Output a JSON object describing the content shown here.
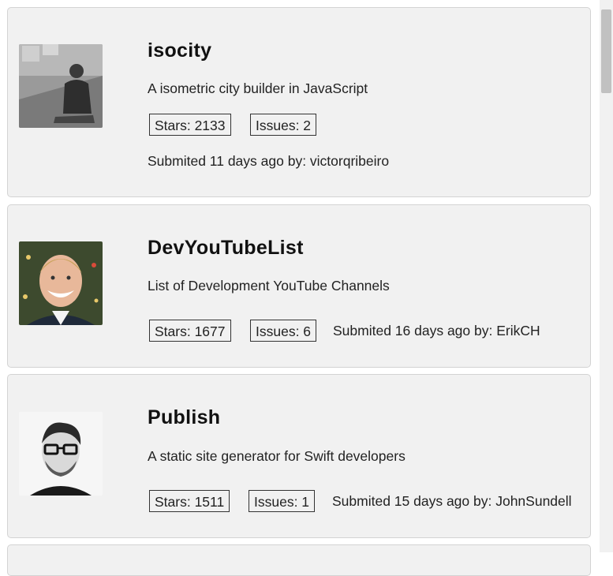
{
  "repos": [
    {
      "name": "isocity",
      "description": "A isometric city builder in JavaScript",
      "stars_label": "Stars: 2133",
      "issues_label": "Issues: 2",
      "submitted_label": "Submited 11 days ago by: victorqribeiro",
      "avatar_icon": "user-photo-grayscale"
    },
    {
      "name": "DevYouTubeList",
      "description": "List of Development YouTube Channels",
      "stars_label": "Stars: 1677",
      "issues_label": "Issues: 6",
      "submitted_label": "Submited 16 days ago by: ErikCH",
      "avatar_icon": "user-photo-color"
    },
    {
      "name": "Publish",
      "description": "A static site generator for Swift developers",
      "stars_label": "Stars: 1511",
      "issues_label": "Issues: 1",
      "submitted_label": "Submited 15 days ago by: JohnSundell",
      "avatar_icon": "user-photo-bw"
    }
  ],
  "colors": {
    "card_background": "#f1f1f1",
    "card_border": "#d3d3d3",
    "badge_border": "#333333",
    "scrollbar_thumb": "#c1c1c1"
  }
}
